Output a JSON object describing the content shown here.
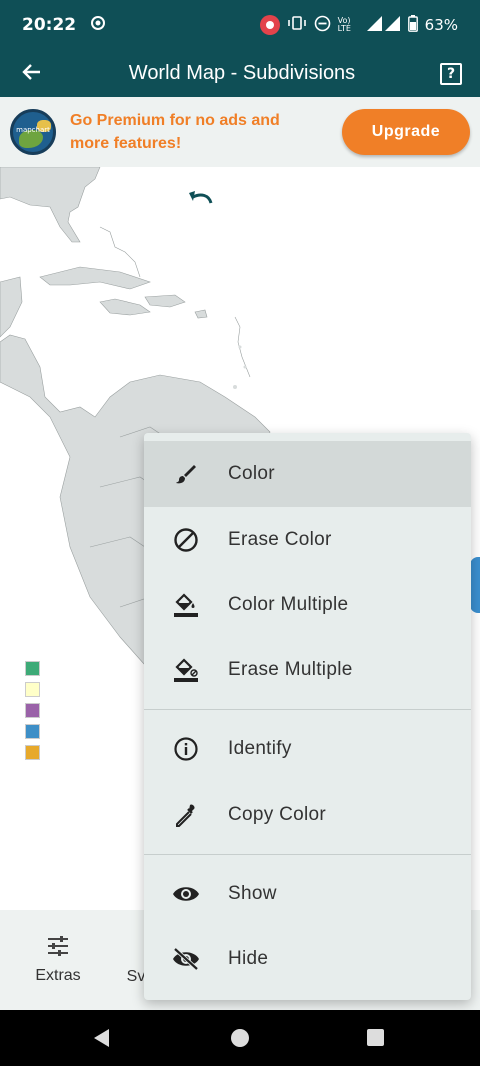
{
  "status_bar": {
    "time": "20:22",
    "battery": "63%",
    "network": "Vo) LTE"
  },
  "app_bar": {
    "title": "World Map - Subdivisions",
    "back_icon": "arrow-back-icon",
    "help_label": "?"
  },
  "promo": {
    "text": "Go Premium for no ads and more features!",
    "button": "Upgrade",
    "logo_text": "mapchart"
  },
  "map": {
    "legend_colors": [
      "#3daa77",
      "#ffffc8",
      "#9a62a8",
      "#3e8fc7",
      "#e7a92b"
    ]
  },
  "menu": {
    "items": [
      {
        "label": "Color",
        "icon": "brush-icon"
      },
      {
        "label": "Erase Color",
        "icon": "block-icon"
      },
      {
        "label": "Color Multiple",
        "icon": "fill-bucket-icon"
      },
      {
        "label": "Erase Multiple",
        "icon": "erase-fill-icon"
      },
      {
        "label": "Identify",
        "icon": "info-icon"
      },
      {
        "label": "Copy Color",
        "icon": "eyedropper-icon"
      },
      {
        "label": "Show",
        "icon": "eye-icon"
      },
      {
        "label": "Hide",
        "icon": "eye-off-icon"
      }
    ]
  },
  "bottom_nav": {
    "extras": "Extras",
    "partial": "Sv"
  }
}
